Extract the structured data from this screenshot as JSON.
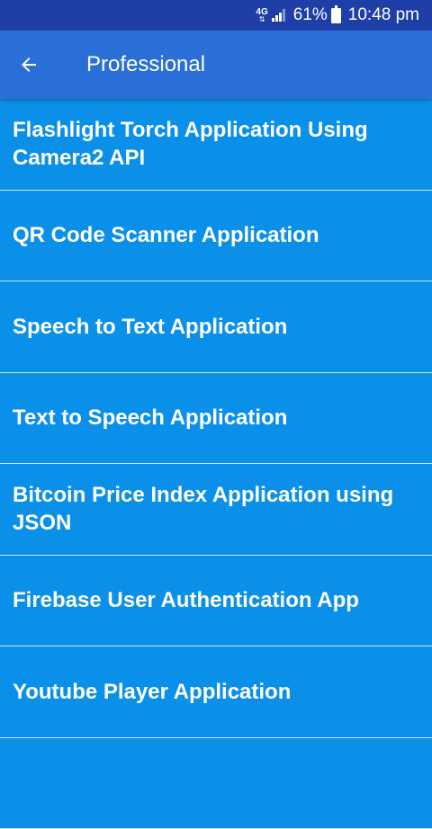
{
  "status_bar": {
    "network": "4G",
    "battery_percent": "61%",
    "time": "10:48 pm"
  },
  "app_bar": {
    "title": "Professional",
    "back_icon": "arrow-left-icon"
  },
  "list": {
    "items": [
      {
        "label": "Flashlight Torch Application Using Camera2 API"
      },
      {
        "label": "QR Code Scanner Application"
      },
      {
        "label": "Speech to Text Application"
      },
      {
        "label": "Text to Speech Application"
      },
      {
        "label": "Bitcoin Price Index Application using JSON"
      },
      {
        "label": "Firebase User Authentication App"
      },
      {
        "label": "Youtube Player Application"
      },
      {
        "label": ""
      }
    ]
  },
  "colors": {
    "status_bar": "#1f3fa8",
    "app_bar": "#2a6fd8",
    "list_background": "#0a90e8",
    "divider": "#c9e6fb"
  }
}
